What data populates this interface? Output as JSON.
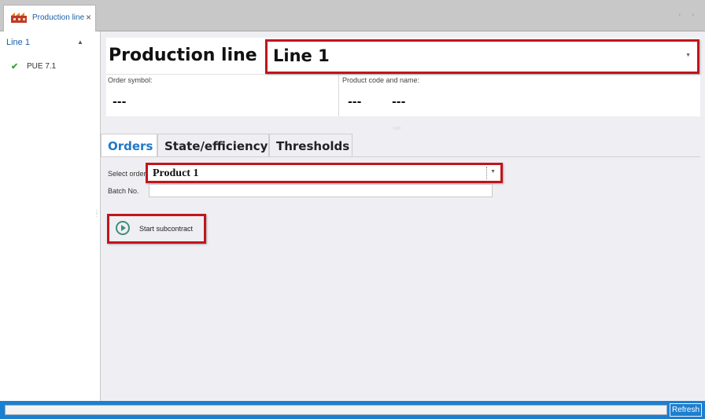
{
  "tab": {
    "title": "Production line",
    "close": "×",
    "scroll_arrows": "‹ ›",
    "icon": "factory-icon"
  },
  "sidebar": {
    "group_label": "Line 1",
    "collapse_arrow": "▲",
    "items": [
      {
        "label": "PUE 7.1",
        "status_icon": "check-icon",
        "status_glyph": "✔"
      }
    ]
  },
  "header": {
    "title": "Production line",
    "line_value": "Line 1",
    "dropdown_arrow": "▼",
    "order_symbol_label": "Order symbol:",
    "order_symbol_value": "---",
    "product_label": "Product code and name:",
    "product_code_value": "---",
    "product_name_value": "---"
  },
  "tabs": [
    {
      "label": "Orders",
      "active": true
    },
    {
      "label": "State/efficiency",
      "active": false
    },
    {
      "label": "Thresholds",
      "active": false
    }
  ],
  "orders": {
    "select_order_label": "Select order",
    "selected_order": "Product 1",
    "dropdown_arrow": "▼",
    "batch_label": "Batch No.",
    "batch_value": "",
    "start_button_label": "Start subcontract"
  },
  "status": {
    "refresh_label": "Refresh"
  },
  "colors": {
    "accent_blue": "#1c7fd0",
    "highlight_red": "#c1151b",
    "tab_active_text": "#2079c8",
    "play_icon": "#3f8f7a"
  }
}
